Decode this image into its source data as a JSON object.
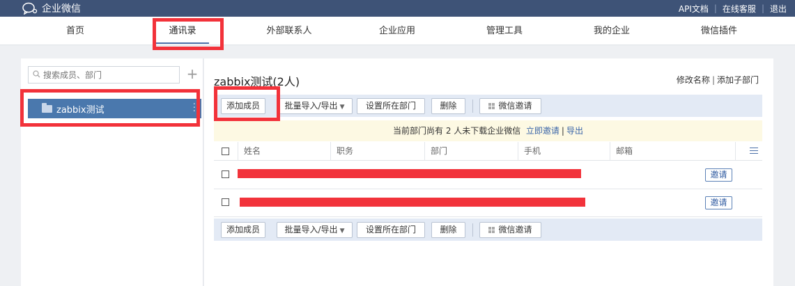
{
  "app": {
    "title": "企业微信"
  },
  "top_links": [
    "API文档",
    "在线客服",
    "退出"
  ],
  "nav": [
    "首页",
    "通讯录",
    "外部联系人",
    "企业应用",
    "管理工具",
    "我的企业",
    "微信插件"
  ],
  "sidebar": {
    "search_placeholder": "搜索成员、部门",
    "plus": "+",
    "dept": "zabbix测试"
  },
  "main": {
    "title": "zabbix测试(2人)",
    "title_links": [
      "修改名称",
      "添加子部门"
    ],
    "toolbar": {
      "add_member": "添加成员",
      "batch": "批量导入/导出",
      "set_dept": "设置所在部门",
      "delete": "删除",
      "wechat_invite": "微信邀请"
    },
    "notice": {
      "text": "当前部门尚有 2 人未下载企业微信",
      "invite": "立即邀请",
      "export": "导出"
    },
    "columns": [
      "姓名",
      "职务",
      "部门",
      "手机",
      "邮箱"
    ],
    "rows": [
      {
        "invite": "邀请"
      },
      {
        "invite": "邀请"
      }
    ]
  },
  "colors": {
    "topbar": "#3e5377",
    "selected": "#4a78ad",
    "highlight": "#f2323a"
  }
}
